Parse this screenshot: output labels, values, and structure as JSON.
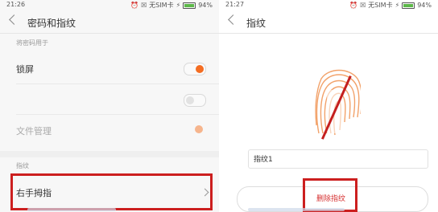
{
  "left": {
    "status": {
      "time": "21:26",
      "carrier": "无SIM卡",
      "battery": "94%"
    },
    "title": "密码和指纹",
    "section_usage": "将密码用于",
    "rows": [
      {
        "label": "锁屏",
        "toggle": "on"
      },
      {
        "label": "",
        "toggle": "off"
      },
      {
        "label": "文件管理",
        "toggle": "on-disabled"
      }
    ],
    "section_fingerprint": "指纹",
    "fingerprint_item": "右手拇指"
  },
  "right": {
    "status": {
      "time": "21:27",
      "carrier": "无SIM卡",
      "battery": "94%"
    },
    "title": "指纹",
    "fingerprint_name": "指纹1",
    "delete_label": "删除指纹"
  },
  "colors": {
    "accent": "#f46d22",
    "annotation_red": "#cc1f1f",
    "delete_red": "#d63030"
  }
}
